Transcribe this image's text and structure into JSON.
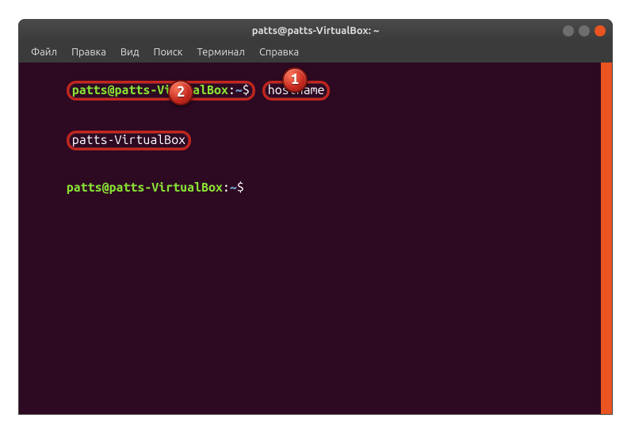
{
  "title": "patts@patts-VirtualBox: ~",
  "menu": {
    "file": "Файл",
    "edit": "Правка",
    "view": "Вид",
    "search": "Поиск",
    "terminal": "Терминал",
    "help": "Справка"
  },
  "prompt": {
    "user_host": "patts@patts-VirtualBox",
    "sep": ":",
    "path": "~",
    "symbol": "$"
  },
  "command1": "hostname",
  "output1": "patts-VirtualBox",
  "callouts": {
    "n1": "1",
    "n2": "2"
  }
}
